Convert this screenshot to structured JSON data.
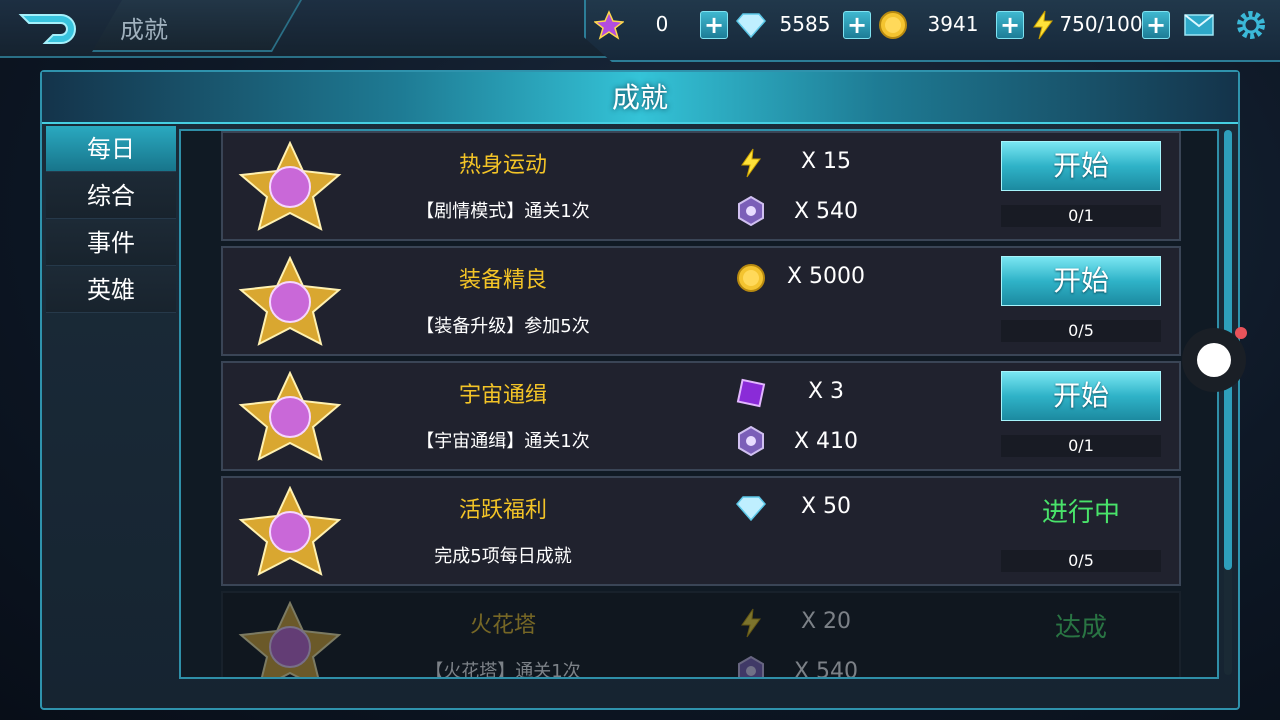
{
  "header": {
    "title": "成就"
  },
  "resources": {
    "stars": "0",
    "diamonds": "5585",
    "gold": "3941",
    "energy": "750/100"
  },
  "panel": {
    "title": "成就"
  },
  "tabs": [
    {
      "label": "每日"
    },
    {
      "label": "综合"
    },
    {
      "label": "事件"
    },
    {
      "label": "英雄"
    }
  ],
  "achievements": [
    {
      "name": "热身运动",
      "desc": "【剧情模式】通关1次",
      "reward1": {
        "icon": "lightning-icon",
        "amount": "X 15"
      },
      "reward2": {
        "icon": "purple-token-icon",
        "amount": "X 540"
      },
      "action": "开始",
      "progress": "0/1"
    },
    {
      "name": "装备精良",
      "desc": "【装备升级】参加5次",
      "reward1": {
        "icon": "gold-coin-icon",
        "amount": "X 5000"
      },
      "action": "开始",
      "progress": "0/5"
    },
    {
      "name": "宇宙通缉",
      "desc": "【宇宙通缉】通关1次",
      "reward1": {
        "icon": "purple-card-icon",
        "amount": "X 3"
      },
      "reward2": {
        "icon": "purple-token-icon",
        "amount": "X 410"
      },
      "action": "开始",
      "progress": "0/1"
    },
    {
      "name": "活跃福利",
      "desc": "完成5项每日成就",
      "reward1": {
        "icon": "diamond-icon",
        "amount": "X 50"
      },
      "status": "进行中",
      "progress": "0/5"
    },
    {
      "name": "火花塔",
      "desc": "【火花塔】通关1次",
      "reward1": {
        "icon": "lightning-icon",
        "amount": "X 20"
      },
      "reward2": {
        "icon": "purple-token-icon",
        "amount": "X 540"
      },
      "status": "达成"
    }
  ],
  "colors": {
    "accent": "#2fb3c8",
    "gold_text": "#f3c427",
    "in_progress": "#49e36a"
  }
}
